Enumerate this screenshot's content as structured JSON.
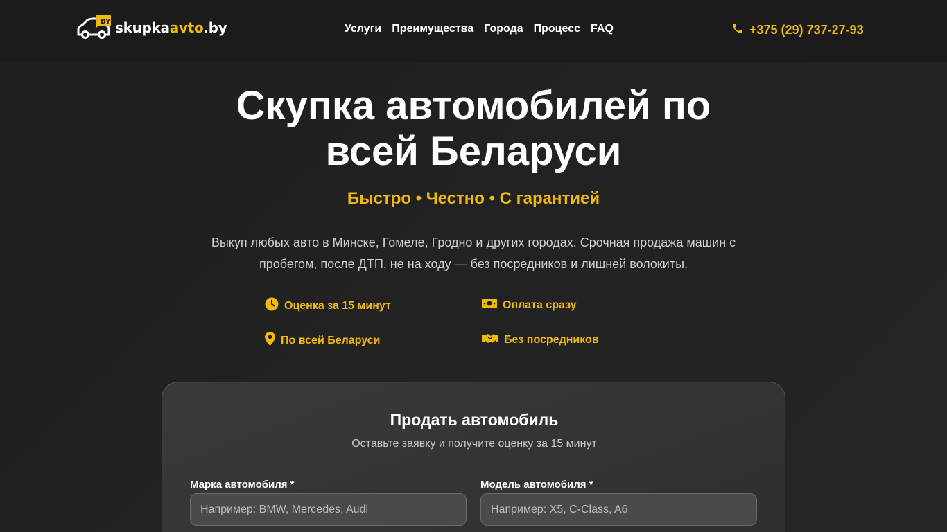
{
  "header": {
    "logo": {
      "badge": "BY",
      "text_white": "skupka",
      "text_yellow": "avto",
      "text_suffix": ".by"
    },
    "nav": [
      "Услуги",
      "Преимущества",
      "Города",
      "Процесс",
      "FAQ"
    ],
    "phone": "+375 (29) 737-27-93"
  },
  "hero": {
    "title_line1": "Скупка автомобилей по",
    "title_line2": "всей Беларуси",
    "subtitle": "Быстро • Честно • С гарантией",
    "desc_line1": "Выкуп любых авто в Минске, Гомеле, Гродно и других городах. Срочная продажа машин с",
    "desc_line2": "пробегом, после ДТП, не на ходу — без посредников и лишней волокиты.",
    "features": [
      {
        "icon": "clock-icon",
        "label": "Оценка за 15 минут"
      },
      {
        "icon": "money-icon",
        "label": "Оплата сразу"
      },
      {
        "icon": "location-pin-icon",
        "label": "По всей Беларуси"
      },
      {
        "icon": "handshake-icon",
        "label": "Без посредников"
      }
    ]
  },
  "form": {
    "title": "Продать автомобиль",
    "subtitle": "Оставьте заявку и получите оценку за 15 минут",
    "brand_label": "Марка автомобиля *",
    "brand_placeholder": "Например: BMW, Mercedes, Audi",
    "brand_value": "",
    "model_label": "Модель автомобиля *",
    "model_placeholder": "Например: X5, C-Class, A6",
    "model_value": ""
  },
  "colors": {
    "accent": "#f0b90b",
    "background": "#1e1e1e",
    "card": "#363636"
  }
}
